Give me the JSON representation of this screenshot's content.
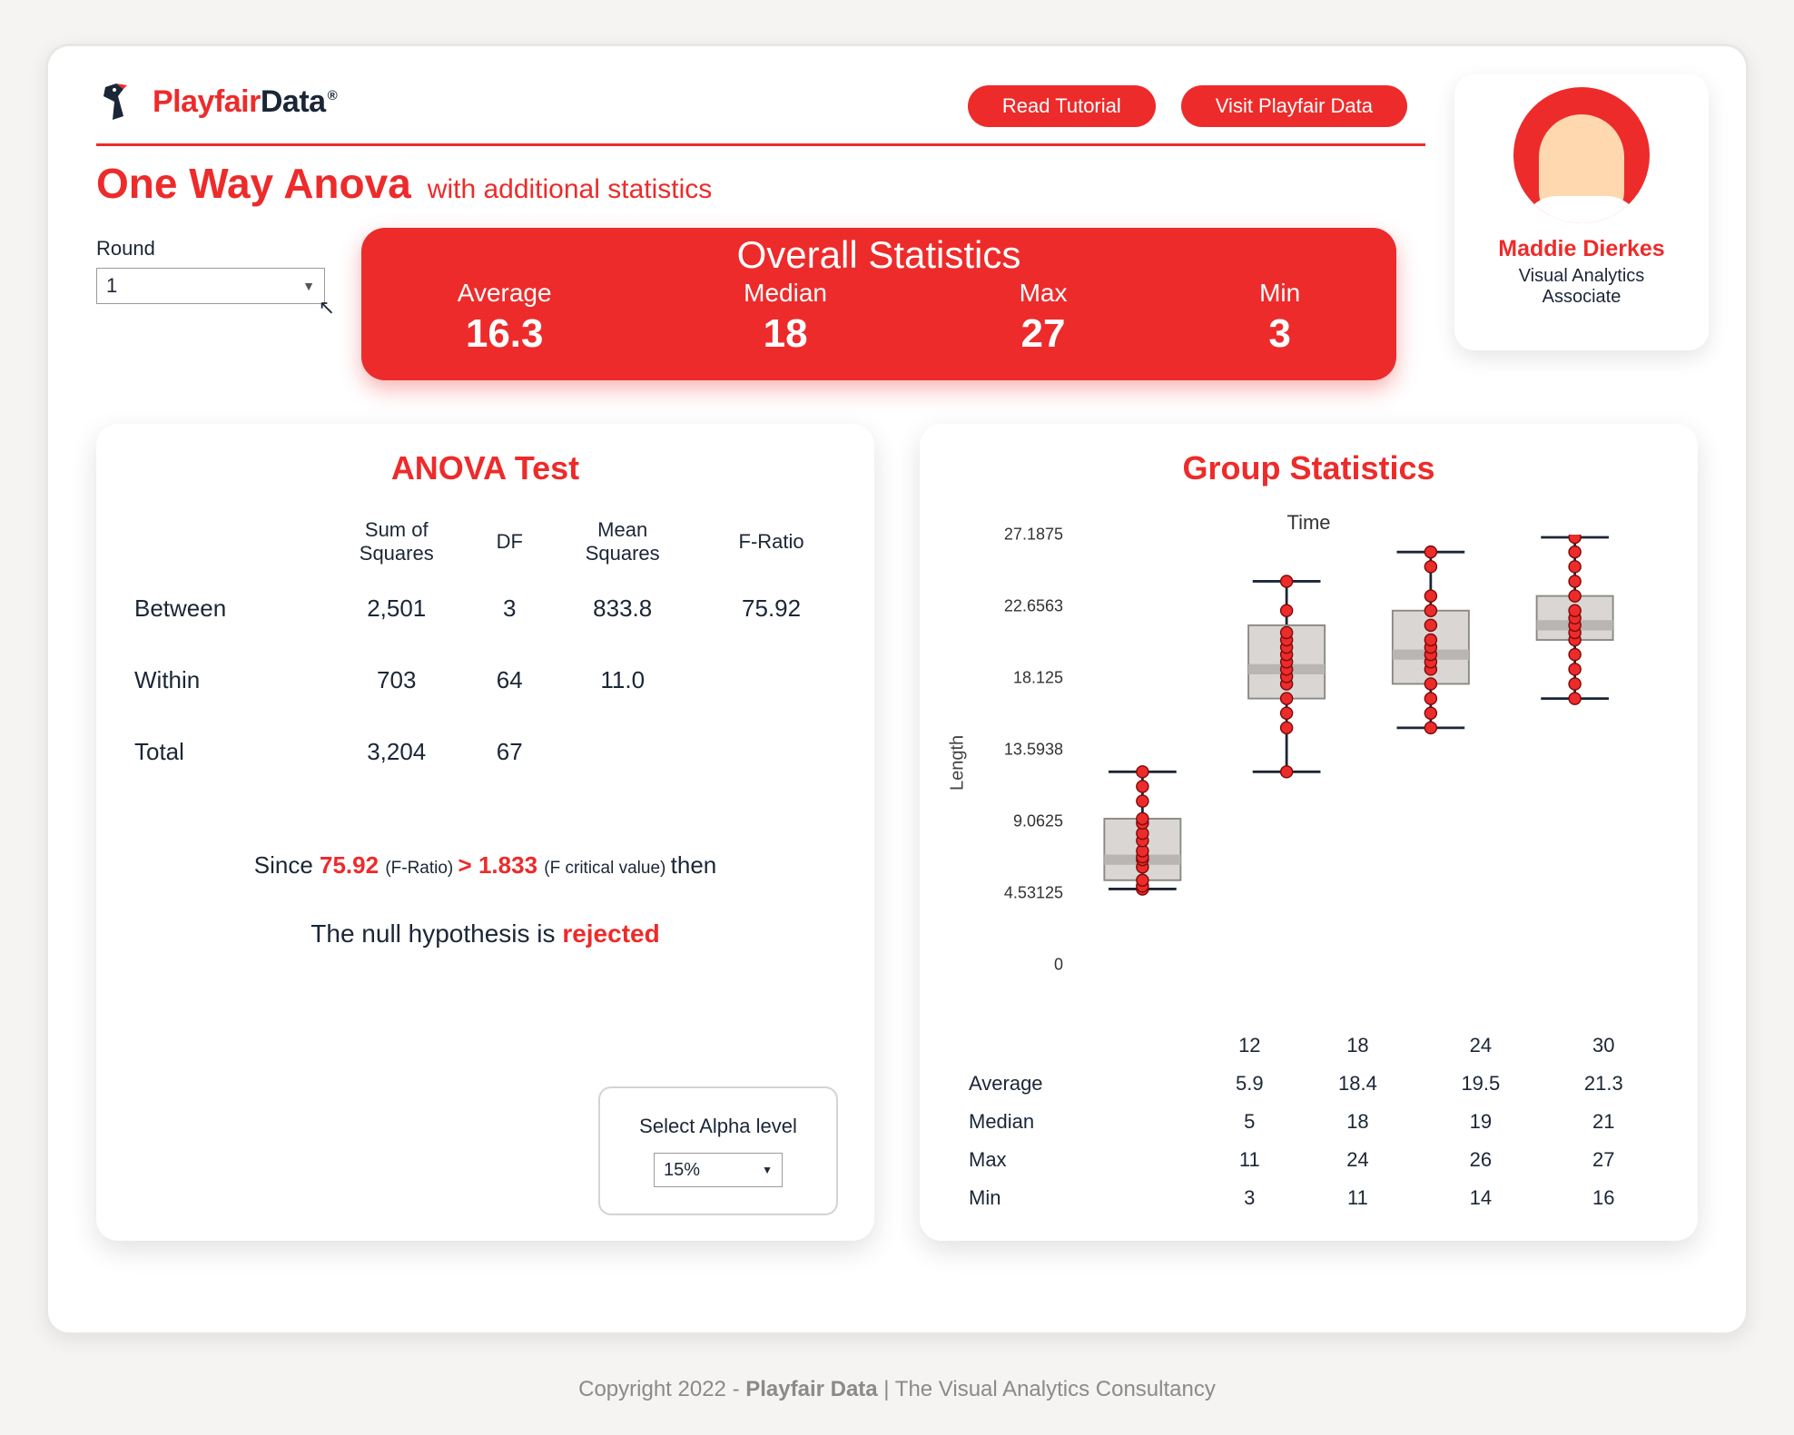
{
  "brand": {
    "part1": "Playfair",
    "part2": "Data",
    "mark": "®"
  },
  "buttons": {
    "tutorial": "Read Tutorial",
    "visit": "Visit Playfair Data"
  },
  "title": {
    "main": "One Way Anova",
    "sub": "with additional statistics"
  },
  "profile": {
    "name": "Maddie Dierkes",
    "role1": "Visual Analytics",
    "role2": "Associate"
  },
  "round": {
    "label": "Round",
    "value": "1"
  },
  "overall": {
    "title": "Overall Statistics",
    "cols": [
      {
        "label": "Average",
        "value": "16.3"
      },
      {
        "label": "Median",
        "value": "18"
      },
      {
        "label": "Max",
        "value": "27"
      },
      {
        "label": "Min",
        "value": "3"
      }
    ]
  },
  "anova": {
    "title": "ANOVA Test",
    "headers": [
      "",
      "Sum of\nSquares",
      "DF",
      "Mean\nSquares",
      "F-Ratio"
    ],
    "rows": [
      {
        "name": "Between",
        "ss": "2,501",
        "df": "3",
        "ms": "833.8",
        "f": "75.92"
      },
      {
        "name": "Within",
        "ss": "703",
        "df": "64",
        "ms": "11.0",
        "f": ""
      },
      {
        "name": "Total",
        "ss": "3,204",
        "df": "67",
        "ms": "",
        "f": ""
      }
    ],
    "verdict": {
      "pre": "Since ",
      "fratio": "75.92",
      "frlbl": " (F-Ratio) ",
      "gt": "> ",
      "fcrit": "1.833",
      "fclbl": " (F critical value) ",
      "post": "then"
    },
    "hypothesis": {
      "pre": "The null hypothesis is ",
      "result": "rejected"
    },
    "alpha": {
      "label": "Select Alpha level",
      "value": "15%"
    }
  },
  "group": {
    "title": "Group Statistics",
    "chart_title": "Time",
    "ylabel": "Length",
    "yticks": [
      "27.1875",
      "22.6563",
      "18.125",
      "13.5938",
      "9.0625",
      "4.53125",
      "0"
    ],
    "xcats": [
      "12",
      "18",
      "24",
      "30"
    ],
    "table": [
      {
        "name": "Average",
        "v": [
          "5.9",
          "18.4",
          "19.5",
          "21.3"
        ]
      },
      {
        "name": "Median",
        "v": [
          "5",
          "18",
          "19",
          "21"
        ]
      },
      {
        "name": "Max",
        "v": [
          "11",
          "24",
          "26",
          "27"
        ]
      },
      {
        "name": "Min",
        "v": [
          "3",
          "11",
          "14",
          "16"
        ]
      }
    ]
  },
  "chart_data": {
    "type": "boxplot",
    "title": "Time",
    "xlabel": "Time",
    "ylabel": "Length",
    "ylim": [
      0,
      27.1875
    ],
    "categories": [
      12,
      18,
      24,
      30
    ],
    "series": [
      {
        "name": "12",
        "min": 3,
        "q1": 3.6,
        "median": 5,
        "q3": 7.8,
        "max": 11,
        "mean": 5.9,
        "points": [
          3,
          3.2,
          3.6,
          4.5,
          5,
          5.2,
          5.6,
          6.3,
          6.8,
          7.5,
          7.8,
          9,
          10,
          11
        ]
      },
      {
        "name": "18",
        "min": 11,
        "q1": 16,
        "median": 18,
        "q3": 21,
        "max": 24,
        "mean": 18.4,
        "points": [
          11,
          14,
          15,
          16,
          17,
          17.5,
          18,
          18.5,
          19,
          19.5,
          20,
          20.5,
          22,
          24
        ]
      },
      {
        "name": "24",
        "min": 14,
        "q1": 17,
        "median": 19,
        "q3": 22,
        "max": 26,
        "mean": 19.5,
        "points": [
          14,
          15,
          16,
          17,
          18,
          18.5,
          19,
          19.5,
          20,
          21,
          22,
          23,
          25,
          26
        ]
      },
      {
        "name": "30",
        "min": 16,
        "q1": 20,
        "median": 21,
        "q3": 23,
        "max": 27,
        "mean": 21.3,
        "points": [
          16,
          17,
          18,
          19,
          20,
          20.5,
          21,
          21.5,
          22,
          23,
          24,
          25,
          26,
          27
        ]
      }
    ]
  },
  "footer": {
    "copy": "Copyright 2022 - ",
    "brand": "Playfair Data",
    "rest": " | The Visual Analytics Consultancy"
  }
}
